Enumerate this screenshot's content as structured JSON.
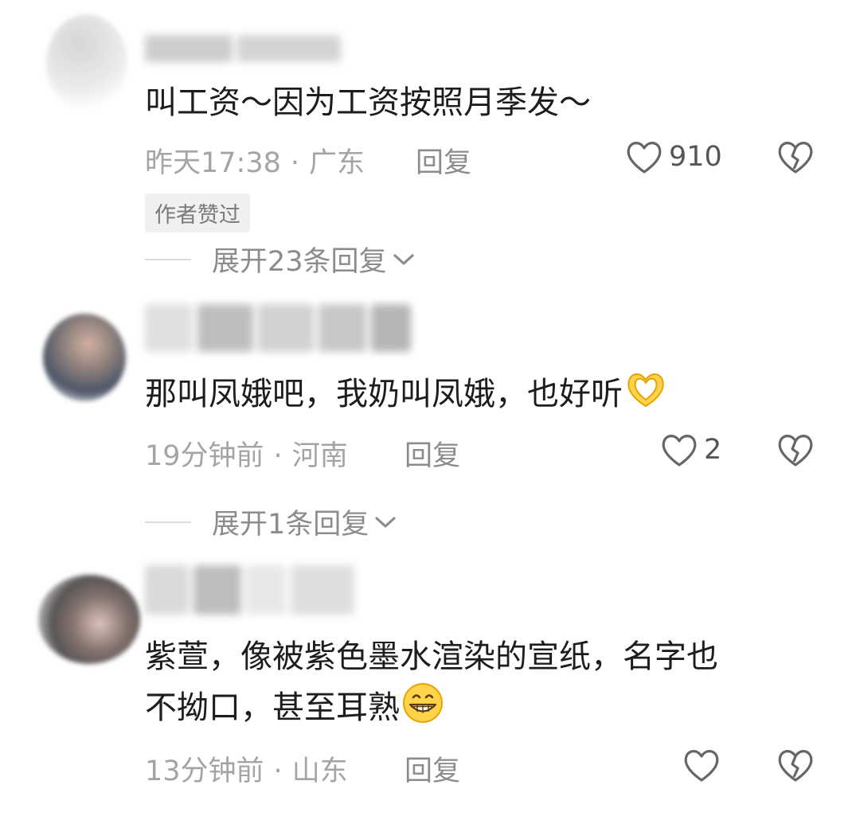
{
  "comments": [
    {
      "content": "叫工资～因为工资按照月季发～",
      "time": "昨天17:38",
      "location": "广东",
      "reply_label": "回复",
      "likes": "910",
      "badge": "作者赞过",
      "expand_label": "展开23条回复"
    },
    {
      "content": "那叫凤娥吧，我奶叫凤娥，也好听",
      "emoji": "heart-hands-emoji",
      "time": "19分钟前",
      "location": "河南",
      "reply_label": "回复",
      "likes": "2",
      "expand_label": "展开1条回复"
    },
    {
      "content_line1": "紫萱，像被紫色墨水渲染的宣纸，名字也",
      "content_line2": "不拗口，甚至耳熟",
      "emoji": "grinning-face-emoji",
      "time": "13分钟前",
      "location": "山东",
      "reply_label": "回复"
    }
  ],
  "separator": "·",
  "colors": {
    "meta_text": "#a4a4a4",
    "content_text": "#1d1d1d",
    "badge_bg": "#f0f0f0"
  }
}
